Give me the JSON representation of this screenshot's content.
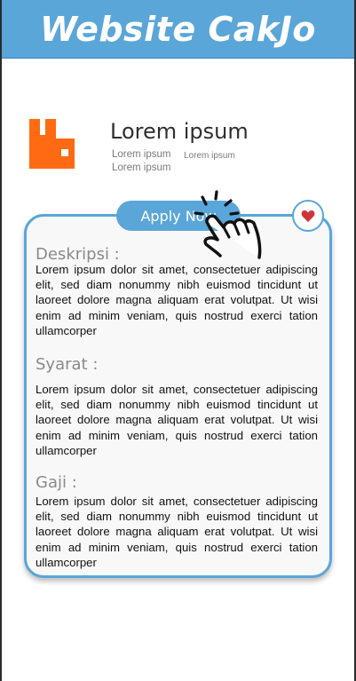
{
  "header": {
    "title": "Website CakJo"
  },
  "company": {
    "name": "Lorem ipsum",
    "sub_line_1": "Lorem ipsum",
    "sub_line_2": "Lorem ipsum",
    "sub_line_3": "Lorem ipsum",
    "logo_icon": "company-logo-icon",
    "logo_color": "#ff6a13"
  },
  "card": {
    "apply_label": "Apply Now",
    "favorite_icon": "heart-icon",
    "pointer_icon": "tap-hand-icon",
    "sections": [
      {
        "title": "Deskripsi :",
        "body": "Lorem ipsum dolor sit amet, consectetuer adipiscing elit, sed diam nonummy nibh euismod tincidunt ut laoreet dolore magna aliquam erat volutpat. Ut wisi enim ad minim veniam, quis nostrud exerci tation ullamcorper"
      },
      {
        "title": "Syarat :",
        "body": "Lorem ipsum dolor sit amet, consectetuer adipiscing elit, sed diam nonummy nibh euismod tincidunt ut laoreet dolore magna aliquam erat volutpat. Ut wisi enim ad minim veniam, quis nostrud exerci tation ullamcorper"
      },
      {
        "title": "Gaji :",
        "body": "Lorem ipsum dolor sit amet, consectetuer adipiscing elit, sed diam nonummy nibh euismod tincidunt ut laoreet dolore magna aliquam erat volutpat. Ut wisi enim ad minim veniam, quis nostrud exerci tation ullamcorper"
      }
    ]
  },
  "colors": {
    "accent": "#5aa6d9",
    "heart": "#d0343b"
  }
}
